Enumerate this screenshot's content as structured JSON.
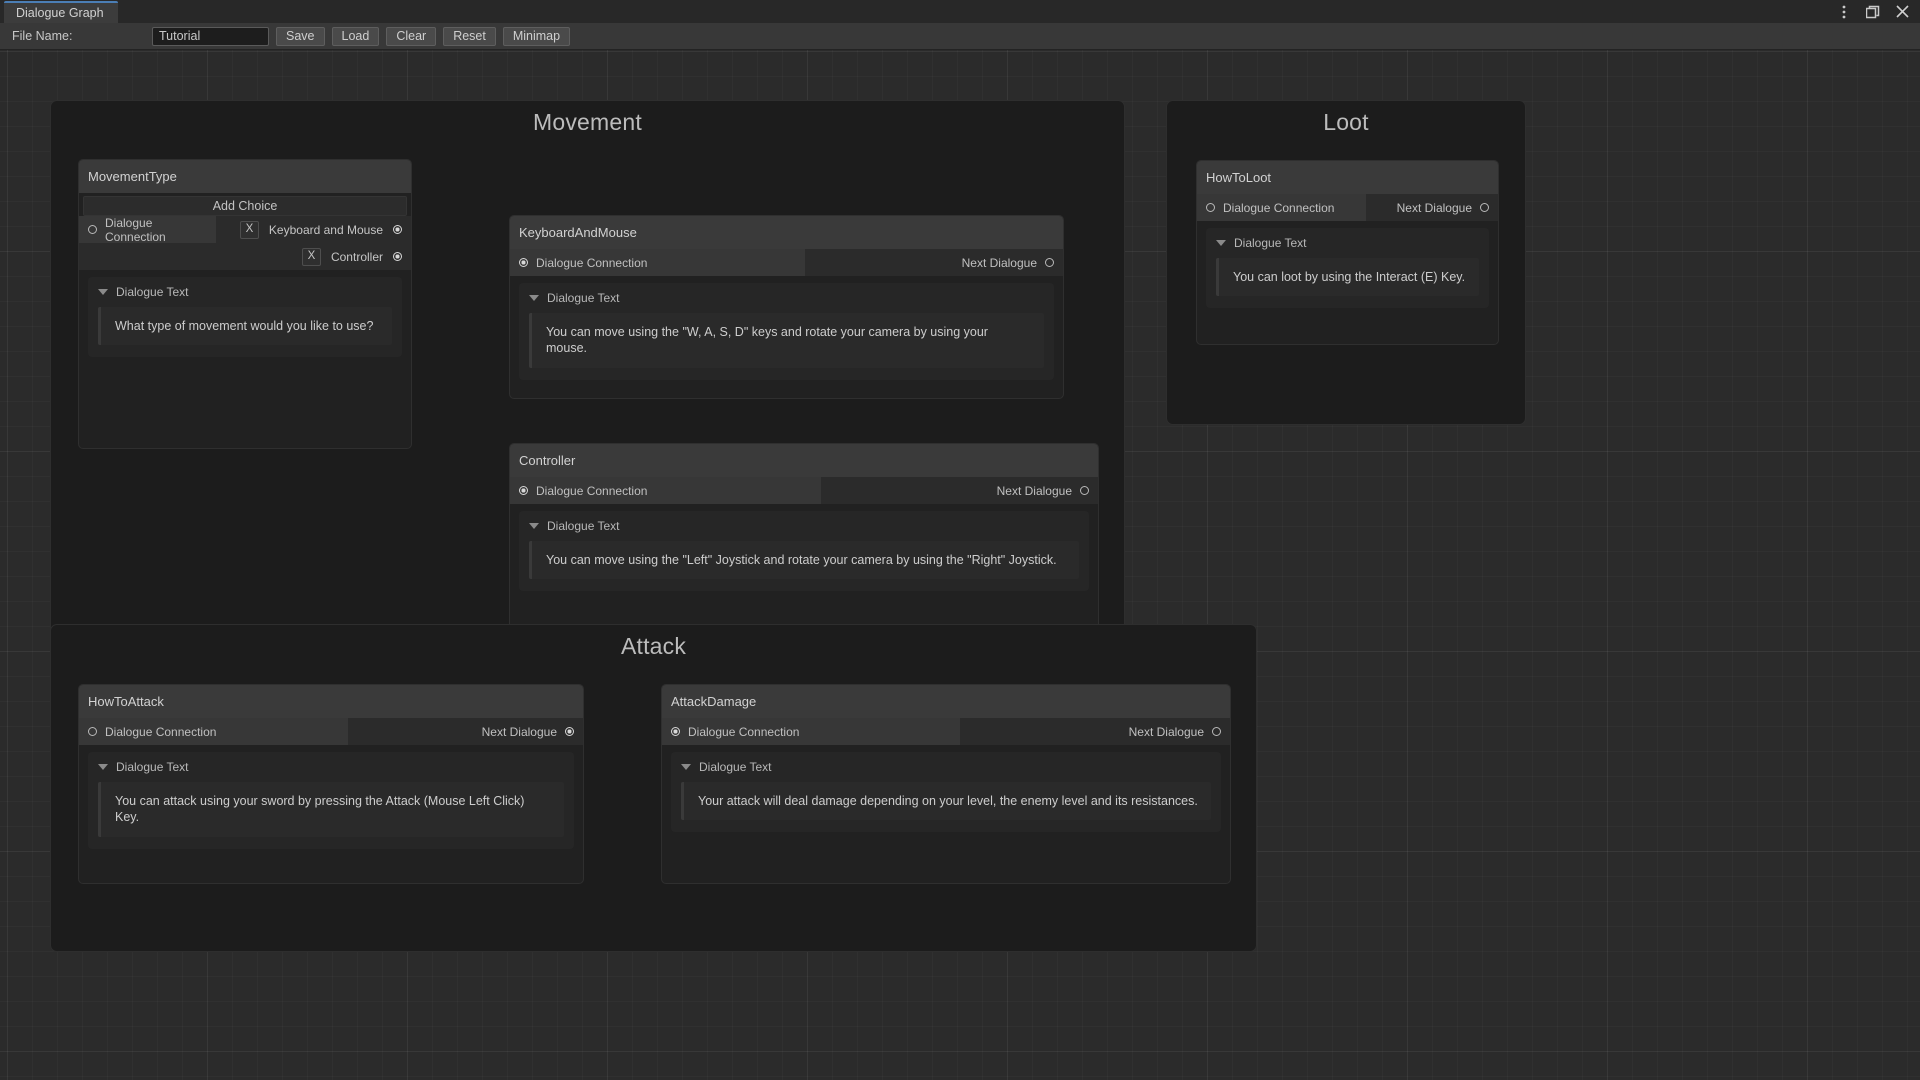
{
  "window": {
    "tab_title": "Dialogue Graph",
    "controls": [
      "kebab-menu-icon",
      "restore-window-icon",
      "close-icon"
    ]
  },
  "toolbar": {
    "file_name_label": "File Name:",
    "file_name_value": "Tutorial",
    "file_name_placeholder": "File Name",
    "buttons": [
      "Save",
      "Load",
      "Clear",
      "Reset",
      "Minimap"
    ]
  },
  "labels": {
    "add_choice": "Add Choice",
    "dialogue_connection": "Dialogue Connection",
    "next_dialogue": "Next Dialogue",
    "dialogue_text": "Dialogue Text",
    "remove": "X"
  },
  "groups": [
    {
      "title": "Movement"
    },
    {
      "title": "Loot"
    },
    {
      "title": "Attack"
    }
  ],
  "nodes": {
    "movement_type": {
      "title": "MovementType",
      "input_port": "Dialogue Connection",
      "input_connected": false,
      "choices": [
        {
          "label": "Keyboard and Mouse",
          "connected": true
        },
        {
          "label": "Controller",
          "connected": true
        }
      ],
      "dialogue_text_label": "Dialogue Text",
      "dialogue_text": "What type of movement would you like to use?"
    },
    "keyboard_and_mouse": {
      "title": "KeyboardAndMouse",
      "input_port": "Dialogue Connection",
      "input_connected": true,
      "output_port": "Next Dialogue",
      "output_connected": false,
      "dialogue_text_label": "Dialogue Text",
      "dialogue_text": "You can move using the \"W, A, S, D\" keys and rotate your camera by using your mouse."
    },
    "controller": {
      "title": "Controller",
      "input_port": "Dialogue Connection",
      "input_connected": true,
      "output_port": "Next Dialogue",
      "output_connected": false,
      "dialogue_text_label": "Dialogue Text",
      "dialogue_text": "You can move using the \"Left\" Joystick and rotate your camera by using the \"Right\" Joystick."
    },
    "how_to_loot": {
      "title": "HowToLoot",
      "input_port": "Dialogue Connection",
      "input_connected": false,
      "output_port": "Next Dialogue",
      "output_connected": false,
      "dialogue_text_label": "Dialogue Text",
      "dialogue_text": "You can loot by using the Interact (E) Key."
    },
    "how_to_attack": {
      "title": "HowToAttack",
      "input_port": "Dialogue Connection",
      "input_connected": false,
      "output_port": "Next Dialogue",
      "output_connected": true,
      "dialogue_text_label": "Dialogue Text",
      "dialogue_text": "You can attack using your sword by pressing the Attack (Mouse Left Click) Key."
    },
    "attack_damage": {
      "title": "AttackDamage",
      "input_port": "Dialogue Connection",
      "input_connected": true,
      "output_port": "Next Dialogue",
      "output_connected": false,
      "dialogue_text_label": "Dialogue Text",
      "dialogue_text": "Your attack will deal damage depending on your level, the enemy level and its resistances."
    }
  },
  "colors": {
    "canvas": "#2b2b2b",
    "group_bg": "#1c1c1c",
    "node_bg": "#212121",
    "node_title": "#3a3a3a",
    "edge": "#e6e6e6",
    "tab_accent": "#4b7eb5"
  }
}
